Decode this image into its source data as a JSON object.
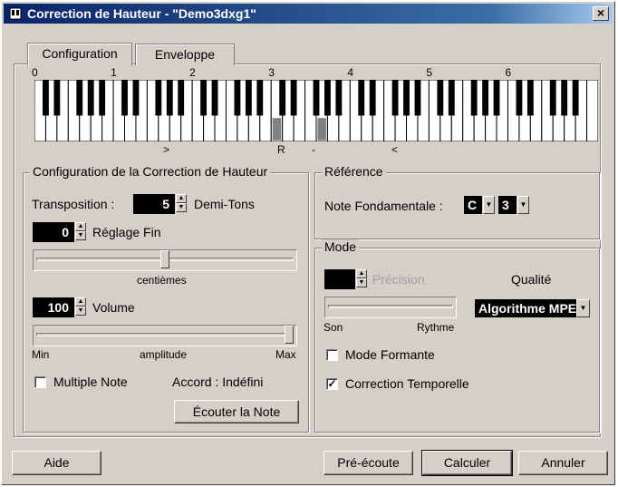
{
  "window": {
    "title": "Correction de Hauteur - \"Demo3dxg1\"",
    "close": "×"
  },
  "tabs": [
    {
      "label": "Configuration"
    },
    {
      "label": "Enveloppe"
    }
  ],
  "keyboard": {
    "octave_labels": [
      "0",
      "1",
      "2",
      "3",
      "4",
      "5",
      "6"
    ],
    "markers": {
      "low": ">",
      "ref": "R",
      "dash": "-",
      "high": "<"
    }
  },
  "correction": {
    "legend": "Configuration de la Correction de Hauteur",
    "transposition_label": "Transposition :",
    "transposition_value": "5",
    "transposition_unit": "Demi-Tons",
    "fine_value": "0",
    "fine_label": "Réglage Fin",
    "fine_slider_value": 0,
    "fine_caption": "centièmes",
    "volume_value": "100",
    "volume_label": "Volume",
    "volume_slider_fraction": 1.0,
    "volume_min": "Min",
    "volume_caption": "amplitude",
    "volume_max": "Max",
    "multiple_note_label": "Multiple Note",
    "multiple_note_checked": false,
    "chord_text": "Accord : Indéfini",
    "listen_button": "Écouter la Note"
  },
  "reference": {
    "legend": "Référence",
    "note_label": "Note Fondamentale :",
    "note_value": "C",
    "octave_value": "3"
  },
  "mode": {
    "legend": "Mode",
    "precision_label": "Précision",
    "quality_label": "Qualité",
    "quality_value": "Algorithme MPEX",
    "son_label": "Son",
    "rythme_label": "Rythme",
    "formant_label": "Mode Formante",
    "formant_checked": false,
    "temporal_label": "Correction Temporelle",
    "temporal_checked": true
  },
  "buttons": {
    "help": "Aide",
    "preview": "Pré-écoute",
    "calculate": "Calculer",
    "cancel": "Annuler"
  }
}
